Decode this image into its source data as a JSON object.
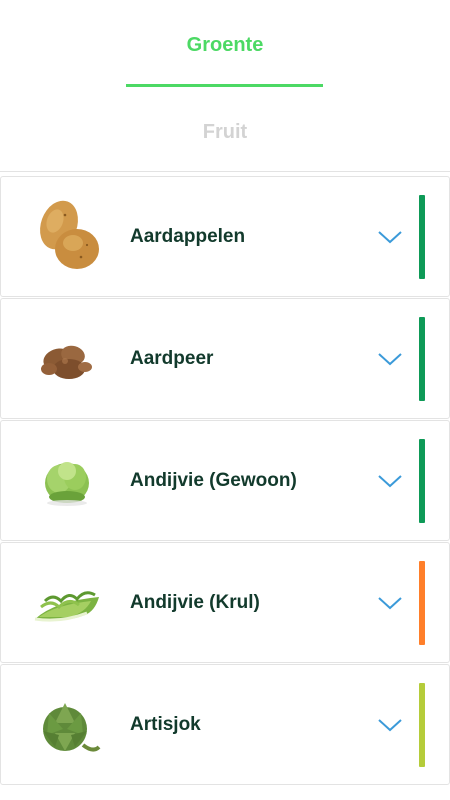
{
  "tabs": {
    "active_label": "Groente",
    "inactive_label": "Fruit",
    "accent_color": "#4cd964"
  },
  "items": [
    {
      "name": "Aardappelen",
      "image": "potato-image",
      "status_color": "#0e9a57"
    },
    {
      "name": "Aardpeer",
      "image": "jerusalem-artichoke-image",
      "status_color": "#0e9a57"
    },
    {
      "name": "Andijvie (Gewoon)",
      "image": "endive-image",
      "status_color": "#0e9a57"
    },
    {
      "name": "Andijvie (Krul)",
      "image": "curly-endive-image",
      "status_color": "#ff7f2a"
    },
    {
      "name": "Artisjok",
      "image": "artichoke-image",
      "status_color": "#b5cc3a"
    }
  ],
  "chevron_color": "#3b9ad9",
  "chevron_icon": "chevron-down-icon"
}
